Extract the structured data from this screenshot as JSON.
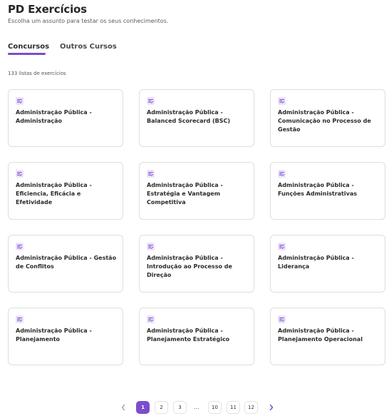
{
  "header": {
    "title": "PD Exercícios",
    "subtitle": "Escolha um assunto para testar os seus conhecimentos."
  },
  "tabs": [
    {
      "label": "Concursos",
      "active": true
    },
    {
      "label": "Outros Cursos",
      "active": false
    }
  ],
  "list_count": "133 listas de exercícios",
  "cards": [
    {
      "title": "Administração Pública - Administração",
      "icon": "list-check-icon"
    },
    {
      "title": "Administração Pública - Balanced Scorecard (BSC)",
      "icon": "list-check-icon"
    },
    {
      "title": "Administração Pública - Comunicação no Processo de Gestão",
      "icon": "list-check-icon"
    },
    {
      "title": "Administração Pública - Eficiencia, Eficácia e Efetividade",
      "icon": "list-check-icon"
    },
    {
      "title": "Administração Pública - Estratégia e Vantagem Competitiva",
      "icon": "list-check-icon"
    },
    {
      "title": "Administração Pública - Funções Administrativas",
      "icon": "list-check-icon"
    },
    {
      "title": "Administração Pública - Gestão de Conflitos",
      "icon": "list-check-icon"
    },
    {
      "title": "Administração Pública - Introdução ao Processo de Direção",
      "icon": "list-check-icon"
    },
    {
      "title": "Administração Pública - Liderança",
      "icon": "list-check-icon"
    },
    {
      "title": "Administração Pública - Planejamento",
      "icon": "list-check-icon"
    },
    {
      "title": "Administração Pública - Planejamento Estratégico",
      "icon": "list-check-icon"
    },
    {
      "title": "Administração Pública - Planejamento Operacional",
      "icon": "list-check-icon"
    }
  ],
  "pagination": {
    "prev_icon": "chevron-left-icon",
    "next_icon": "chevron-right-icon",
    "pages": [
      "1",
      "2",
      "3"
    ],
    "ellipsis": "...",
    "last_pages": [
      "10",
      "11",
      "12"
    ],
    "current": "1"
  },
  "colors": {
    "accent": "#7c4dcc",
    "icon_bg": "#ece4fb"
  }
}
